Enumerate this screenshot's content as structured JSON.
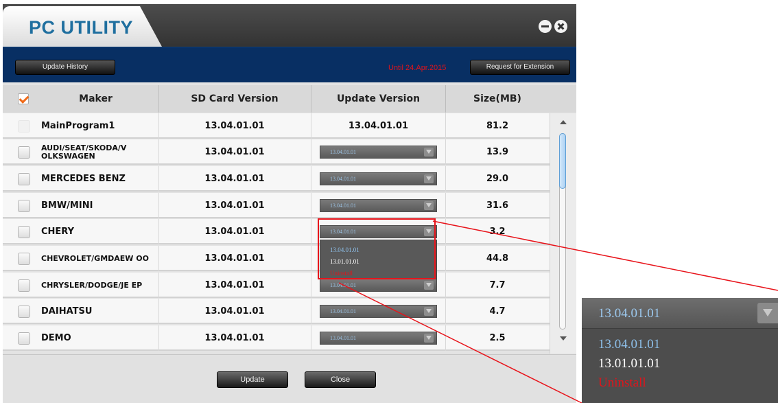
{
  "app": {
    "title": "PC UTILITY",
    "minimize_icon": "minimize-icon",
    "close_icon": "close-icon"
  },
  "toolbar": {
    "update_history_label": "Update History",
    "until_text": "Until 24.Apr.2015",
    "request_extension_label": "Request for Extension"
  },
  "table": {
    "columns": [
      "Maker",
      "SD Card Version",
      "Update Version",
      "Size(MB)"
    ],
    "rows": [
      {
        "maker": "MainProgram1",
        "sd_version": "13.04.01.01",
        "update_version": "13.04.01.01",
        "size": "81.2"
      },
      {
        "maker": "AUDI/SEAT/SKODA/V OLKSWAGEN",
        "sd_version": "13.04.01.01",
        "update_version": "13.04.01.01",
        "size": "13.9"
      },
      {
        "maker": "MERCEDES BENZ",
        "sd_version": "13.04.01.01",
        "update_version": "13.04.01.01",
        "size": "29.0"
      },
      {
        "maker": "BMW/MINI",
        "sd_version": "13.04.01.01",
        "update_version": "13.04.01.01",
        "size": "31.6"
      },
      {
        "maker": "CHERY",
        "sd_version": "13.04.01.01",
        "update_version": "13.04.01.01",
        "size": "3.2"
      },
      {
        "maker": "CHEVROLET/GMDAEW OO",
        "sd_version": "13.04.01.01",
        "update_version": "13.04.01.01",
        "size": "44.8"
      },
      {
        "maker": "CHRYSLER/DODGE/JE EP",
        "sd_version": "13.04.01.01",
        "update_version": "13.04.01.01",
        "size": "7.7"
      },
      {
        "maker": "DAIHATSU",
        "sd_version": "13.04.01.01",
        "update_version": "13.04.01.01",
        "size": "4.7"
      },
      {
        "maker": "DEMO",
        "sd_version": "13.04.01.01",
        "update_version": "13.04.01.01",
        "size": "2.5"
      }
    ]
  },
  "dropdown_options": [
    {
      "label": "13.04.01.01",
      "color": "#8ec0ea"
    },
    {
      "label": "13.01.01.01",
      "color": "#ffffff"
    },
    {
      "label": "Uninstall",
      "color": "#e0141b"
    }
  ],
  "footer": {
    "update_label": "Update",
    "close_label": "Close"
  },
  "colors": {
    "title": "#1f6f9f",
    "toolbar_bg": "#082f63",
    "until_text": "#e0141b",
    "highlight": "#e8141b"
  }
}
